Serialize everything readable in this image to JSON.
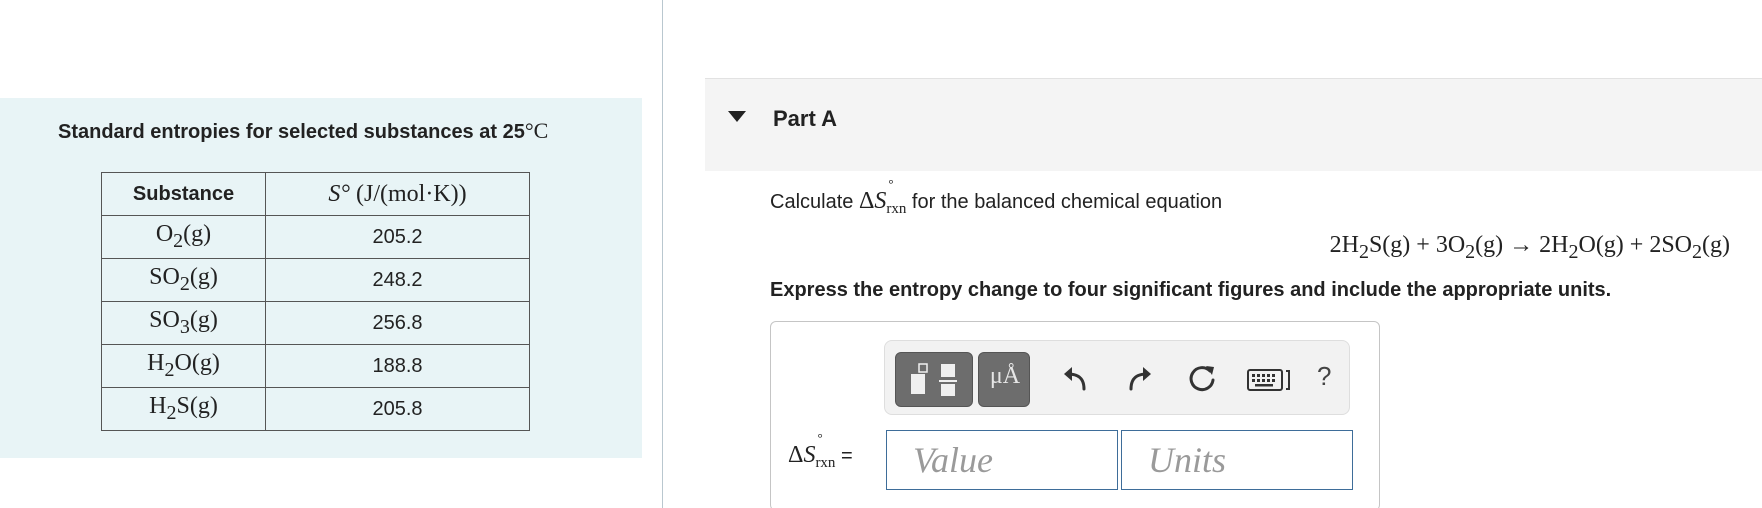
{
  "left_panel": {
    "title_text": "Standard entropies for selected substances at 25",
    "title_unit": "°C",
    "table": {
      "headers": {
        "substance": "Substance",
        "entropy_symbol": "S°",
        "entropy_unit": "(J/(mol·K))"
      },
      "rows": [
        {
          "formula": "O",
          "sub1": "2",
          "rest": "(g)",
          "value": "205.2"
        },
        {
          "formula": "SO",
          "sub1": "2",
          "rest": "(g)",
          "value": "248.2"
        },
        {
          "formula": "SO",
          "sub1": "3",
          "rest": "(g)",
          "value": "256.8"
        },
        {
          "formula": "H",
          "sub1": "2",
          "rest": "O(g)",
          "value": "188.8"
        },
        {
          "formula": "H",
          "sub1": "2",
          "rest": "S(g)",
          "value": "205.8"
        }
      ]
    }
  },
  "part": {
    "title": "Part A",
    "question_prefix": "Calculate ",
    "delta": "Δ",
    "s": "S",
    "degree": "°",
    "rxn": "rxn",
    "question_suffix": " for the balanced chemical equation",
    "equation": {
      "r1_coef": "2H",
      "r1_sub": "2",
      "r1_rest": "S(g) + 3O",
      "r2_sub": "2",
      "r2_rest": "(g) → 2H",
      "p1_sub": "2",
      "p1_rest": "O(g) + 2SO",
      "p2_sub": "2",
      "p2_rest": "(g)"
    },
    "instruction": "Express the entropy change to four significant figures and include the appropriate units."
  },
  "toolbar": {
    "symbols_label": "μÅ",
    "help_label": "?",
    "icons": [
      "templates-icon",
      "symbols-icon",
      "undo-icon",
      "redo-icon",
      "reset-icon",
      "keyboard-icon",
      "help-icon"
    ]
  },
  "answer": {
    "label_suffix": " =",
    "value_placeholder": "Value",
    "units_placeholder": "Units"
  }
}
